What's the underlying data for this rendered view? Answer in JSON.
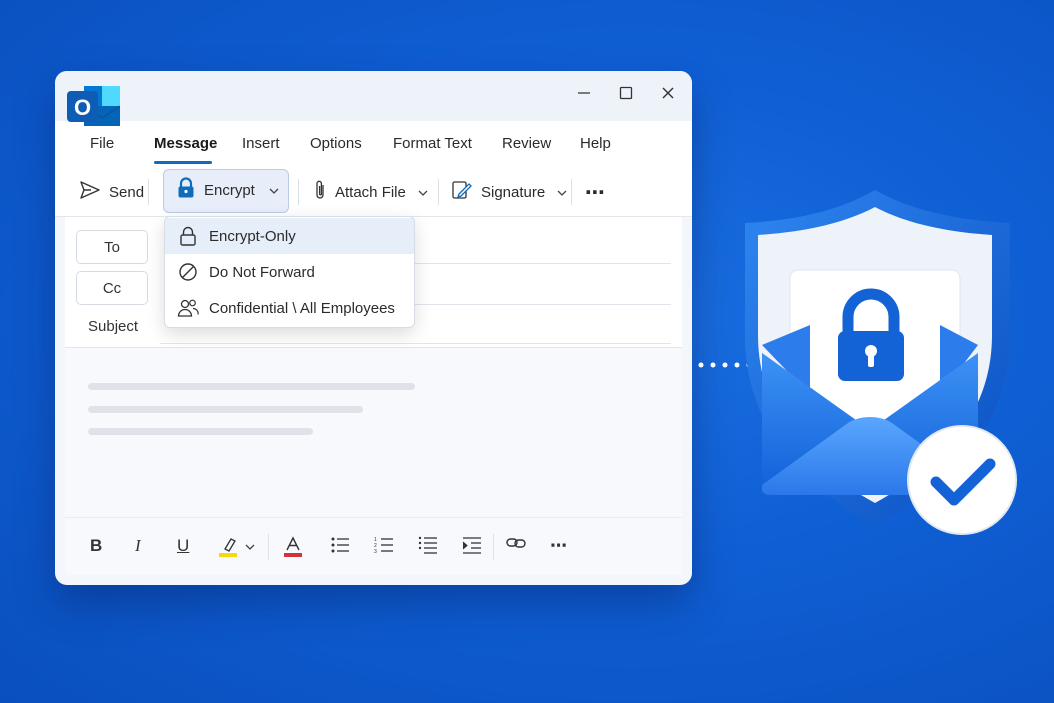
{
  "window": {
    "logo_letter": "O",
    "controls": [
      "minimize-icon",
      "maximize-icon",
      "close-icon"
    ]
  },
  "menu": {
    "tabs": [
      {
        "label": "File",
        "active": false
      },
      {
        "label": "Message",
        "active": true
      },
      {
        "label": "Insert",
        "active": false
      },
      {
        "label": "Options",
        "active": false
      },
      {
        "label": "Format Text",
        "active": false
      },
      {
        "label": "Review",
        "active": false
      },
      {
        "label": "Help",
        "active": false
      }
    ]
  },
  "toolbar": {
    "send_label": "Send",
    "encrypt_label": "Encrypt",
    "attach_label": "Attach File",
    "signature_label": "Signature",
    "more_label": "⋯"
  },
  "encrypt_menu": {
    "items": [
      {
        "label": "Encrypt-Only",
        "icon": "lock-icon",
        "highlighted": true
      },
      {
        "label": "Do Not Forward",
        "icon": "prohibited-icon",
        "highlighted": false
      },
      {
        "label": "Confidential \\ All Employees",
        "icon": "people-icon",
        "highlighted": false
      }
    ]
  },
  "compose": {
    "to_label": "To",
    "cc_label": "Cc",
    "subject_label": "Subject"
  },
  "format_bar": {
    "bold": "B",
    "italic": "I",
    "underline": "U",
    "more": "⋯"
  },
  "colors": {
    "background": "#0f5fd4",
    "accent": "#0f6cbd",
    "highlight_yellow": "#f5d90a",
    "font_red": "#d13438",
    "check_blue": "#1463d6"
  }
}
